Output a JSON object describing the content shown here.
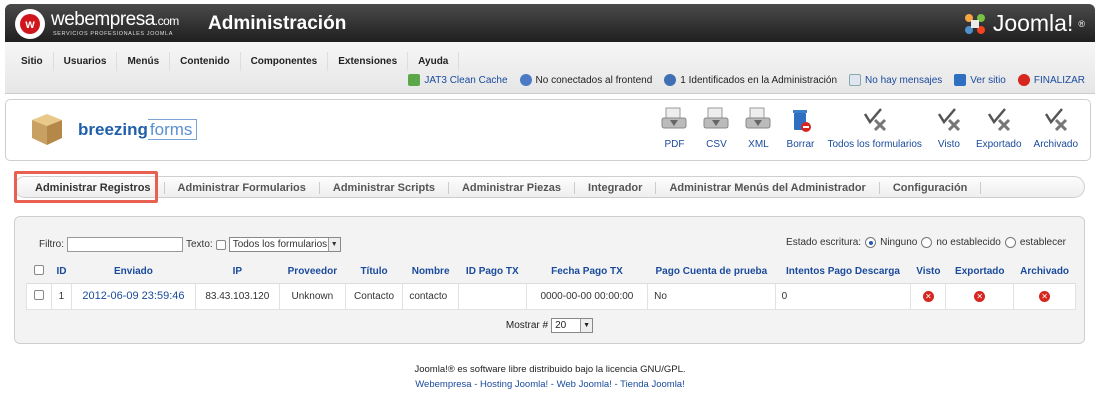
{
  "header": {
    "brand": "webempresa",
    "brand_suffix": ".com",
    "tagline": "SERVICIOS PROFESIONALES JOOMLA",
    "title": "Administración",
    "joomla": "Joomla!",
    "joomla_mark": "®"
  },
  "menu": {
    "items": [
      "Sitio",
      "Usuarios",
      "Menús",
      "Contenido",
      "Componentes",
      "Extensiones",
      "Ayuda"
    ]
  },
  "status": {
    "cache": "JAT3 Clean Cache",
    "frontend": "No conectados al frontend",
    "admin": "1 Identificados en la Administración",
    "messages": "No hay mensajes",
    "site": "Ver sitio",
    "logout": "FINALIZAR"
  },
  "component": {
    "logo_bold": "breezing",
    "logo_light": "forms"
  },
  "toolbar": {
    "pdf": "PDF",
    "csv": "CSV",
    "xml": "XML",
    "delete": "Borrar",
    "all_forms": "Todos los formularios",
    "viewed": "Visto",
    "exported": "Exportado",
    "archived": "Archivado"
  },
  "tabs": [
    "Administrar Registros",
    "Administrar Formularios",
    "Administrar Scripts",
    "Administrar Piezas",
    "Integrador",
    "Administrar Menús del Administrador",
    "Configuración"
  ],
  "filters": {
    "filter_label": "Filtro:",
    "filter_value": "",
    "text_label": "Texto:",
    "form_select": "Todos los formularios",
    "estado_label": "Estado escritura:",
    "estado_options": [
      "Ninguno",
      "no establecido",
      "establecer"
    ],
    "estado_selected": 0
  },
  "table": {
    "columns": [
      "ID",
      "Enviado",
      "IP",
      "Proveedor",
      "Título",
      "Nombre",
      "ID Pago TX",
      "Fecha Pago TX",
      "Pago Cuenta de prueba",
      "Intentos Pago Descarga",
      "Visto",
      "Exportado",
      "Archivado"
    ],
    "rows": [
      {
        "id": "1",
        "enviado": "2012-06-09 23:59:46",
        "ip": "83.43.103.120",
        "proveedor": "Unknown",
        "titulo": "Contacto",
        "nombre": "contacto",
        "id_pago_tx": "",
        "fecha_pago_tx": "0000-00-00 00:00:00",
        "pago_cuenta_prueba": "No",
        "intentos_pago_descarga": "0"
      }
    ]
  },
  "pager": {
    "label": "Mostrar #",
    "value": "20"
  },
  "footer": {
    "license": "Joomla!® es software libre distribuido bajo la licencia GNU/GPL.",
    "links": "Webempresa - Hosting Joomla! - Web Joomla! - Tienda Joomla!"
  },
  "colors": {
    "link": "#1a4a9c",
    "highlight": "#e8604f",
    "delete_red": "#d7251f",
    "brand_red": "#d0151c"
  }
}
